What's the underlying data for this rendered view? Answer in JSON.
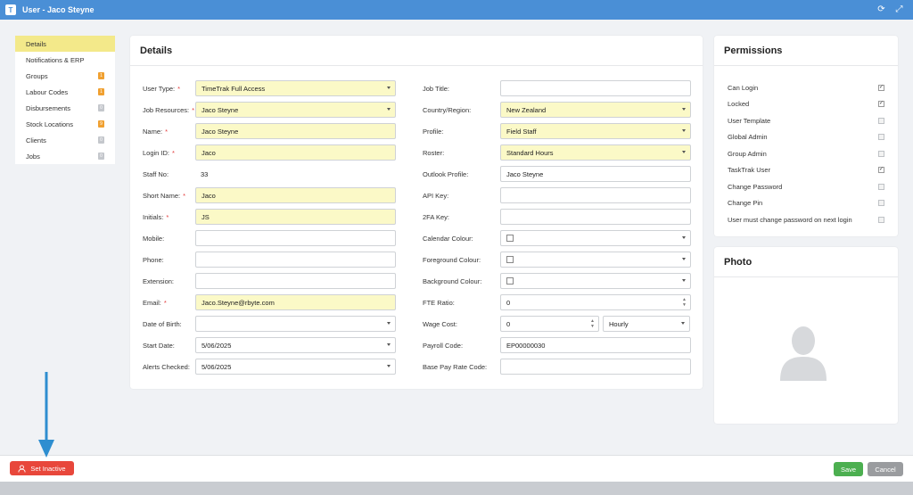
{
  "window": {
    "logo": "T",
    "title": "User - Jaco Steyne",
    "icons": [
      "refresh-icon",
      "fullscreen-icon"
    ]
  },
  "sidebar": {
    "items": [
      {
        "label": "Details",
        "active": true,
        "badge": null
      },
      {
        "label": "Notifications & ERP",
        "badge": null
      },
      {
        "label": "Groups",
        "badge": "1",
        "badge_color": "orange"
      },
      {
        "label": "Labour Codes",
        "badge": "1",
        "badge_color": "orange"
      },
      {
        "label": "Disbursements",
        "badge": "0",
        "badge_color": "grey"
      },
      {
        "label": "Stock Locations",
        "badge": "9",
        "badge_color": "orange"
      },
      {
        "label": "Clients",
        "badge": "0",
        "badge_color": "grey"
      },
      {
        "label": "Jobs",
        "badge": "0",
        "badge_color": "grey"
      }
    ]
  },
  "details": {
    "title": "Details",
    "left": [
      {
        "label": "User Type:",
        "required": true,
        "value": "TimeTrak Full Access",
        "type": "select",
        "highlight": true
      },
      {
        "label": "Job Resources:",
        "required": true,
        "value": "Jaco Steyne",
        "type": "select",
        "highlight": true
      },
      {
        "label": "Name:",
        "required": true,
        "value": "Jaco Steyne",
        "type": "text",
        "highlight": true
      },
      {
        "label": "Login ID:",
        "required": true,
        "value": "Jaco",
        "type": "text",
        "highlight": true
      },
      {
        "label": "Staff No:",
        "required": false,
        "value": "33",
        "type": "plain"
      },
      {
        "label": "Short Name:",
        "required": true,
        "value": "Jaco",
        "type": "text",
        "highlight": true
      },
      {
        "label": "Initials:",
        "required": true,
        "value": "JS",
        "type": "text",
        "highlight": true
      },
      {
        "label": "Mobile:",
        "required": false,
        "value": "",
        "type": "text"
      },
      {
        "label": "Phone:",
        "required": false,
        "value": "",
        "type": "text"
      },
      {
        "label": "Extension:",
        "required": false,
        "value": "",
        "type": "text"
      },
      {
        "label": "Email:",
        "required": true,
        "value": "Jaco.Steyne@rbyte.com",
        "type": "text",
        "highlight": true
      },
      {
        "label": "Date of Birth:",
        "required": false,
        "value": "",
        "type": "select"
      },
      {
        "label": "Start Date:",
        "required": false,
        "value": "5/06/2025",
        "type": "select"
      },
      {
        "label": "Alerts Checked:",
        "required": false,
        "value": "5/06/2025",
        "type": "select"
      }
    ],
    "right": [
      {
        "label": "Job Title:",
        "value": "",
        "type": "text"
      },
      {
        "label": "Country/Region:",
        "value": "New Zealand",
        "type": "select",
        "highlight": true
      },
      {
        "label": "Profile:",
        "value": "Field Staff",
        "type": "select",
        "highlight": true
      },
      {
        "label": "Roster:",
        "value": "Standard Hours",
        "type": "select",
        "highlight": true
      },
      {
        "label": "Outlook Profile:",
        "value": "Jaco Steyne",
        "type": "text"
      },
      {
        "label": "API Key:",
        "value": "",
        "type": "text"
      },
      {
        "label": "2FA Key:",
        "value": "",
        "type": "text"
      },
      {
        "label": "Calendar Colour:",
        "value": "",
        "type": "colour"
      },
      {
        "label": "Foreground Colour:",
        "value": "",
        "type": "colour"
      },
      {
        "label": "Background Colour:",
        "value": "",
        "type": "colour"
      },
      {
        "label": "FTE Ratio:",
        "value": "0",
        "type": "number"
      },
      {
        "label": "Wage Cost:",
        "value": "0",
        "type": "wage",
        "unit": "Hourly"
      },
      {
        "label": "Payroll Code:",
        "value": "EP00000030",
        "type": "text"
      },
      {
        "label": "Base Pay Rate Code:",
        "value": "",
        "type": "text"
      }
    ]
  },
  "permissions": {
    "title": "Permissions",
    "items": [
      {
        "label": "Can Login",
        "checked": true
      },
      {
        "label": "Locked",
        "checked": true
      },
      {
        "label": "User Template",
        "checked": false
      },
      {
        "label": "Global Admin",
        "checked": false
      },
      {
        "label": "Group Admin",
        "checked": false
      },
      {
        "label": "TaskTrak User",
        "checked": true
      },
      {
        "label": "Change Password",
        "checked": false
      },
      {
        "label": "Change Pin",
        "checked": false
      },
      {
        "label": "User must change password on next login",
        "checked": false
      }
    ]
  },
  "photo": {
    "title": "Photo"
  },
  "footer": {
    "set_inactive": "Set Inactive",
    "save": "Save",
    "cancel": "Cancel"
  },
  "colors": {
    "titlebar": "#4a8fd6",
    "highlight": "#fbf9c7",
    "active_nav": "#f3e98a",
    "danger": "#e8473b",
    "success": "#4caf50",
    "badge": "#f0a030"
  }
}
